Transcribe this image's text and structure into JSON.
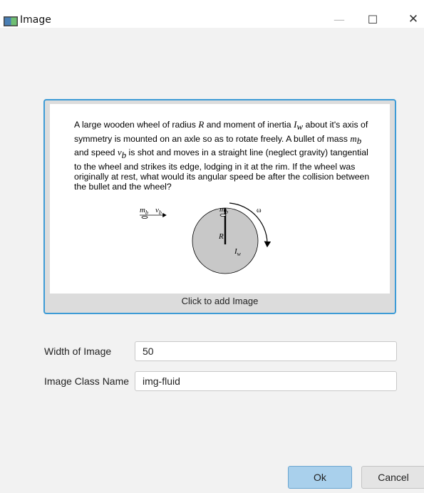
{
  "window": {
    "title": "Image",
    "minimize_glyph": "—",
    "maximize_glyph": "☐",
    "close_glyph": "✕"
  },
  "image_panel": {
    "problem_text_parts": [
      "A large wooden wheel of radius ",
      "R",
      " and moment of inertia ",
      "I",
      "w",
      " about it's axis of symmetry is mounted on an axle so as to rotate freely. A bullet of mass ",
      "m",
      "b",
      " and speed ",
      "v",
      "b",
      " is shot and moves in a straight line (neglect gravity) tangential to the wheel and strikes its edge, lodging in it at the rim. If the wheel was originally at rest, what would its angular speed be after the collision between the bullet and the wheel?"
    ],
    "diagram": {
      "bullet_mass_label": "m",
      "bullet_mass_sub": "b",
      "bullet_speed_label": "v",
      "bullet_speed_sub": "b",
      "rim_mass_label": "m",
      "rim_mass_sub": "b",
      "radius_label": "R",
      "inertia_label": "I",
      "inertia_sub": "w",
      "omega_label": "ω",
      "wheel_fill": "#c8c8c8"
    },
    "add_image_label": "Click to add Image"
  },
  "form": {
    "width_label": "Width of Image",
    "width_value": "50",
    "class_label": "Image Class Name",
    "class_value": "img-fluid"
  },
  "buttons": {
    "ok_label": "Ok",
    "cancel_label": "Cancel"
  },
  "colors": {
    "accent": "#3d9bd6",
    "ok_bg": "#a9d0ec"
  }
}
